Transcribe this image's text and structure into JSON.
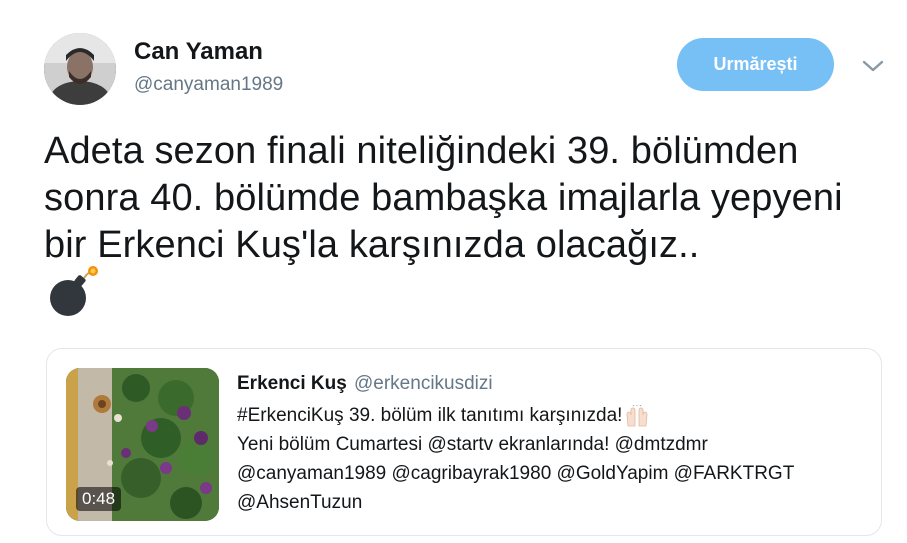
{
  "tweet": {
    "author_name": "Can Yaman",
    "author_handle": "@canyaman1989",
    "follow_label": "Urmărești",
    "text": "Adeta sezon finali niteliğindeki 39. bölümden sonra 40. bölümde bambaşka imajlarla yepyeni bir Erkenci Kuş'la karşınızda olacağız..",
    "emoji": "bomb-icon"
  },
  "quoted_tweet": {
    "author_name": "Erkenci Kuş",
    "author_handle": "@erkencikusdizi",
    "lines": [
      "#ErkenciKuş 39. bölüm ilk tanıtımı karşınızda!",
      "Yeni bölüm Cumartesi @startv ekranlarında! @dmtzdmr",
      "@canyaman1989 @cagribayrak1980 @GoldYapim @FARKTRGT",
      "@AhsenTuzun"
    ],
    "video_duration": "0:48"
  },
  "colors": {
    "follow_button": "#77c0f5",
    "secondary_text": "#657786",
    "border": "#e1e8ed"
  }
}
